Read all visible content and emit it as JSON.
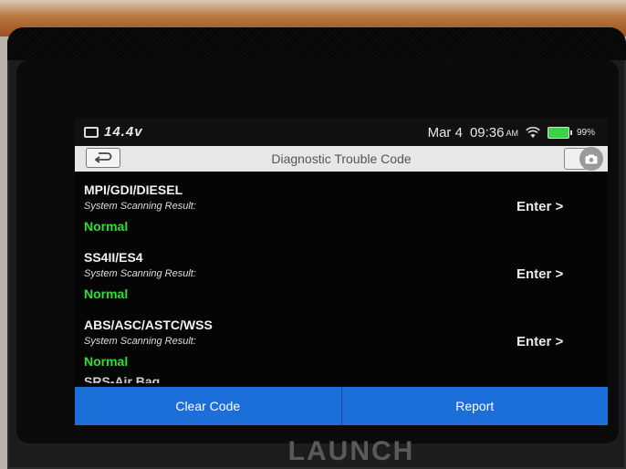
{
  "device": {
    "brand": "LAUNCH"
  },
  "status_bar": {
    "voltage": "14.4v",
    "date": "Mar 4",
    "time": "09:36",
    "ampm": "AM",
    "battery_pct": "99%"
  },
  "title_bar": {
    "title": "Diagnostic Trouble Code"
  },
  "systems": [
    {
      "name": "MPI/GDI/DIESEL",
      "scan_label": "System Scanning Result:",
      "result": "Normal",
      "action": "Enter >"
    },
    {
      "name": "SS4II/ES4",
      "scan_label": "System Scanning Result:",
      "result": "Normal",
      "action": "Enter >"
    },
    {
      "name": "ABS/ASC/ASTC/WSS",
      "scan_label": "System Scanning Result:",
      "result": "Normal",
      "action": "Enter >"
    }
  ],
  "partial_next": "SRS-Air Bag",
  "bottom_bar": {
    "clear_code": "Clear Code",
    "report": "Report"
  },
  "colors": {
    "accent_blue": "#1c6ed8",
    "normal_green": "#2de02d"
  },
  "icons": [
    "car-battery-icon",
    "wifi-icon",
    "battery-icon",
    "back-arrow-icon",
    "camera-icon"
  ]
}
